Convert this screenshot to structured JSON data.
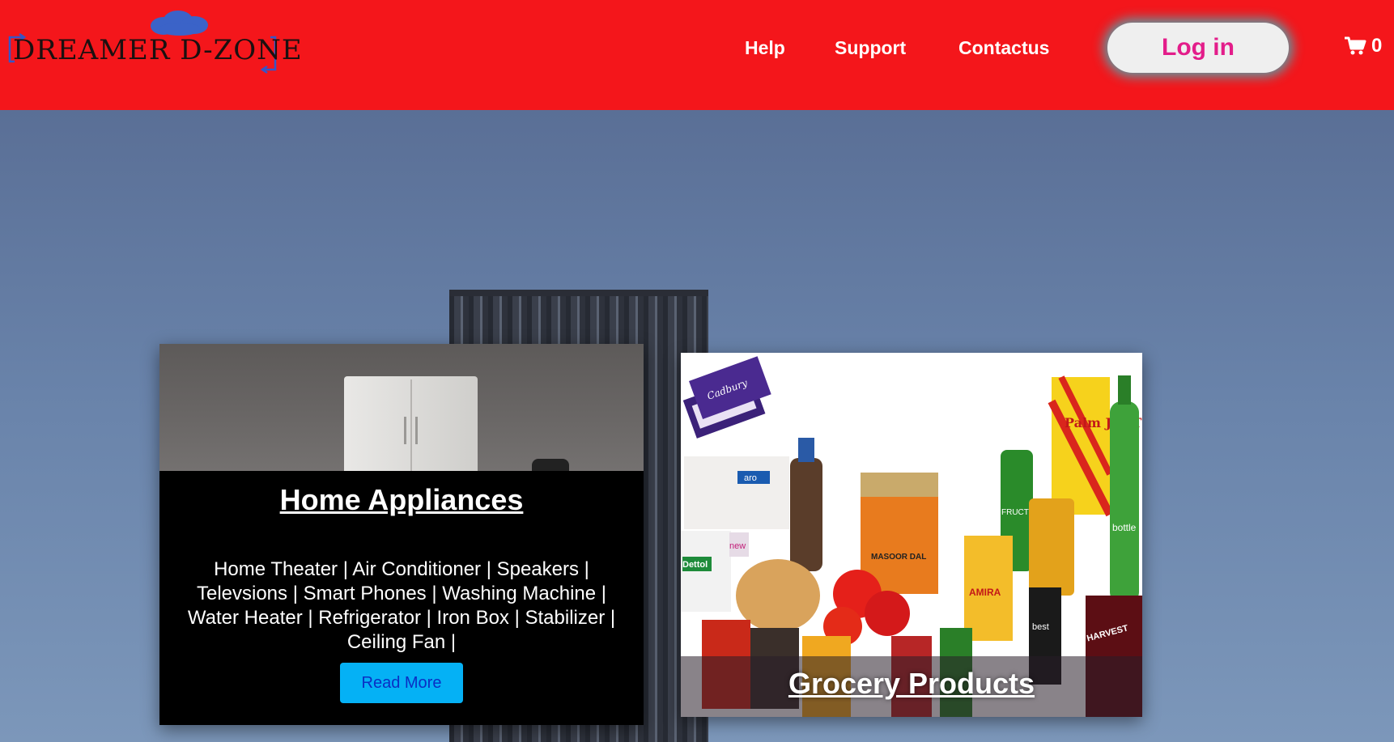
{
  "header": {
    "logo_text": "DREAMER D-ZONE",
    "nav": {
      "help": "Help",
      "support": "Support",
      "contact": "Contactus"
    },
    "login_label": "Log in",
    "cart_count": "0"
  },
  "cards": {
    "home": {
      "title": "Home Appliances",
      "description": "Home Theater | Air Conditioner | Speakers | Televsions | Smart Phones | Washing Machine | Water Heater | Refrigerator | Iron Box | Stabilizer | Ceiling Fan |",
      "button": "Read More"
    },
    "grocery": {
      "title": "Grocery Products",
      "product_labels": {
        "cadbury": "Cadbury",
        "aro": "aro",
        "dettol": "Dettol",
        "masoor": "MASOOR DAL",
        "palm": "Palm JYOTHI",
        "bottle_green": "bottle green",
        "fructis": "FRUCTIS",
        "amira": "AMIRA",
        "harvest": "HARVEST",
        "best": "best",
        "new": "new"
      }
    }
  },
  "colors": {
    "header_bg": "#f4161b",
    "login_text": "#e31d8a",
    "read_more_bg": "#05b1f5"
  },
  "icons": {
    "cart": "shopping-cart-icon",
    "logo_cloud": "cloud-icon"
  }
}
